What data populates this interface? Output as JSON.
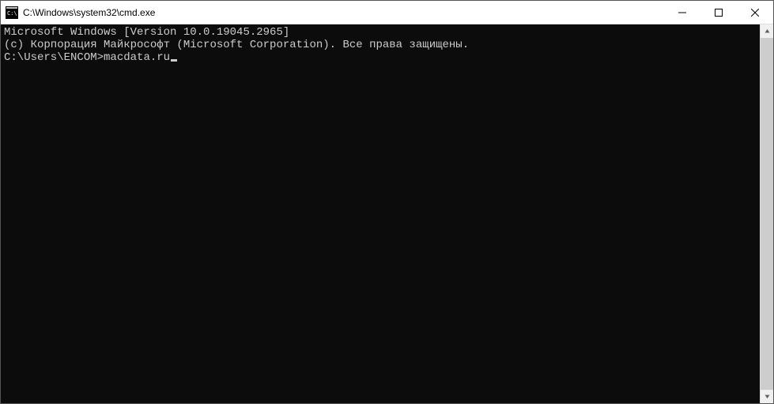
{
  "titlebar": {
    "title": "C:\\Windows\\system32\\cmd.exe"
  },
  "terminal": {
    "line1": "Microsoft Windows [Version 10.0.19045.2965]",
    "line2": "(c) Корпорация Майкрософт (Microsoft Corporation). Все права защищены.",
    "blank": "",
    "prompt": "C:\\Users\\ENCOM>",
    "command": "macdata.ru"
  }
}
